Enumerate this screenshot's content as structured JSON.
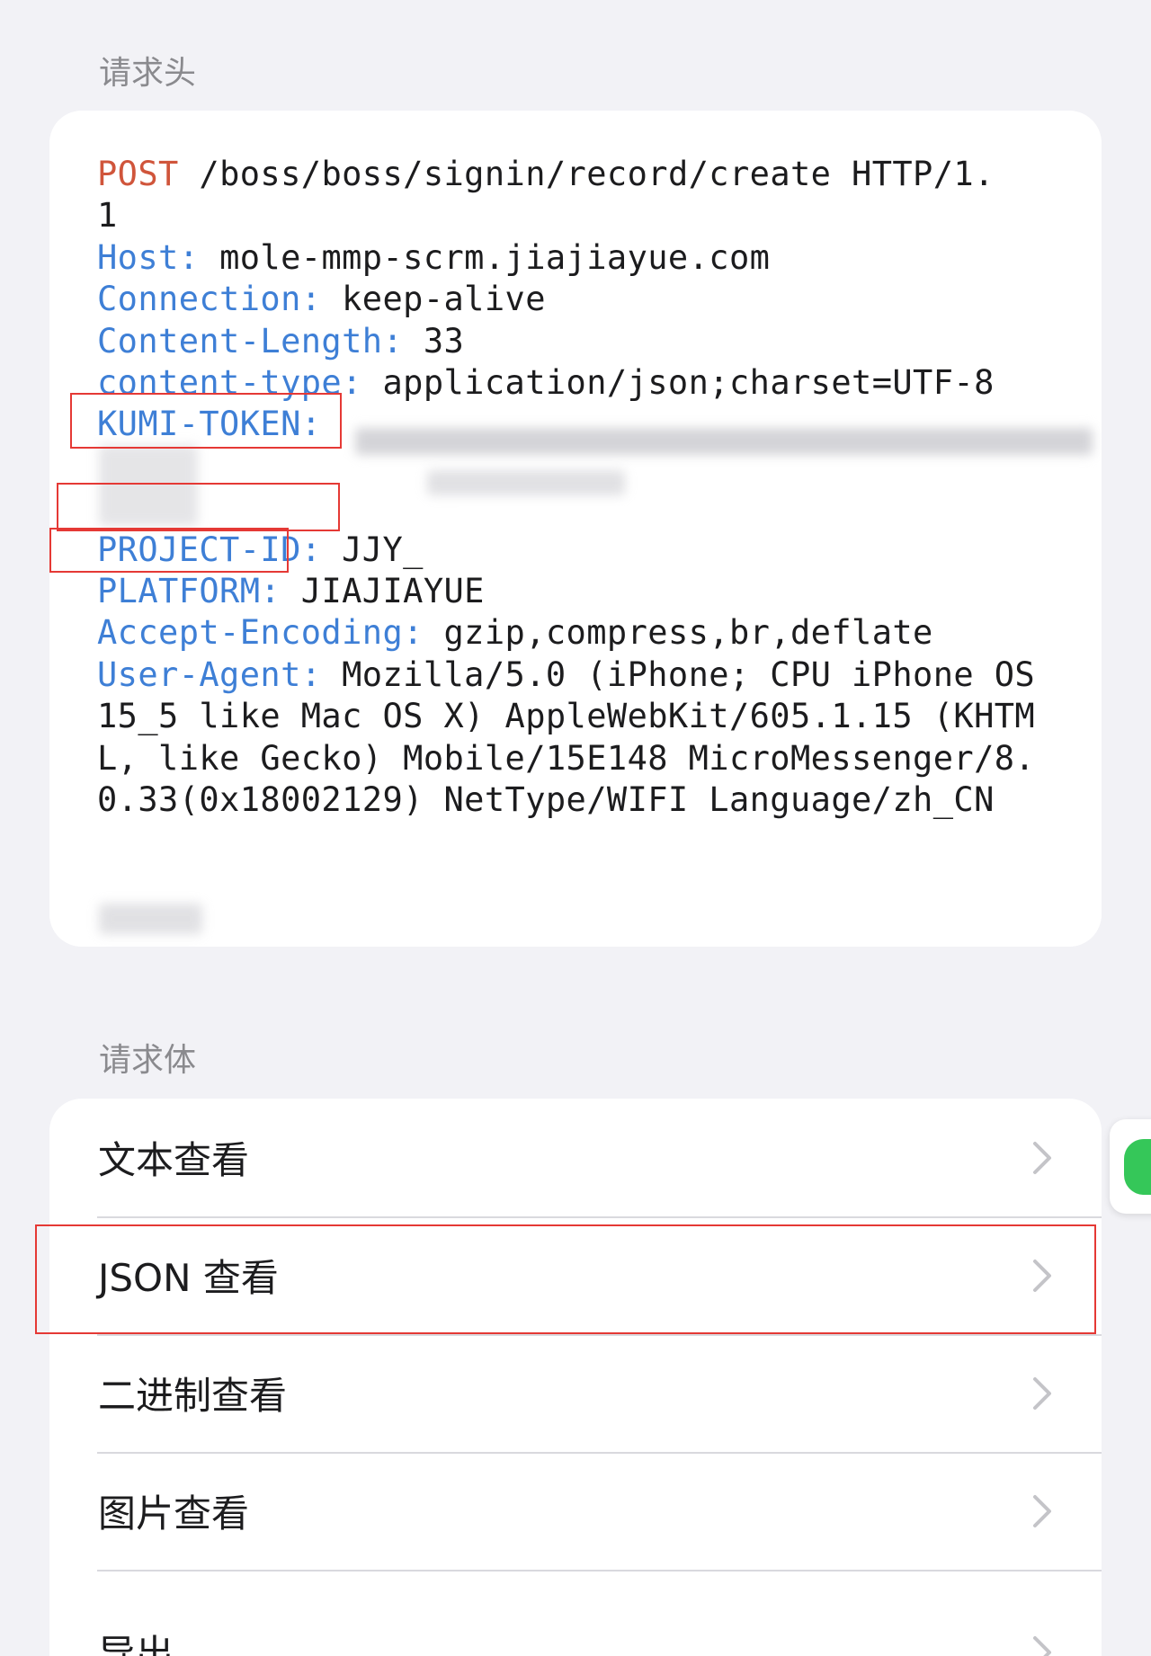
{
  "headers_section": {
    "title": "请求头",
    "request_line": {
      "method": "POST",
      "path": " /boss/boss/signin/record/create HTTP/1.\n1"
    },
    "headers": [
      {
        "key": "Host:",
        "value": " mole-mmp-scrm.jiajiayue.com"
      },
      {
        "key": "Connection:",
        "value": " keep-alive"
      },
      {
        "key": "Content-Length:",
        "value": " 33"
      },
      {
        "key": "content-type:",
        "value": " application/json;charset=UTF-8"
      },
      {
        "key": "KUMI-TOKEN:",
        "value": ""
      },
      {
        "key": "PROJECT-ID:",
        "value": " JJY_"
      },
      {
        "key": "PLATFORM:",
        "value": " JIAJIAYUE"
      },
      {
        "key": "Accept-Encoding:",
        "value": " gzip,compress,br,deflate"
      },
      {
        "key": "User-Agent:",
        "value": " Mozilla/5.0 (iPhone; CPU iPhone OS 15_5 like Mac OS X) AppleWebKit/605.1.15 (KHTML, like Gecko) Mobile/15E148 MicroMessenger/8.0.33(0x18002129) NetType/WIFI Language/zh_CN"
      }
    ]
  },
  "body_section": {
    "title": "请求体",
    "items": [
      {
        "label": "文本查看"
      },
      {
        "label": "JSON 查看"
      },
      {
        "label": "二进制查看"
      },
      {
        "label": "图片查看"
      },
      {
        "label": "导出"
      }
    ]
  },
  "colors": {
    "background": "#f2f2f6",
    "card": "#ffffff",
    "header_key": "#3e7fd6",
    "method": "#d0553b",
    "annotation": "#e53935",
    "section_title": "#8a8a8e"
  },
  "icons": [
    "chevron-right-icon",
    "message-bubble-icon"
  ]
}
